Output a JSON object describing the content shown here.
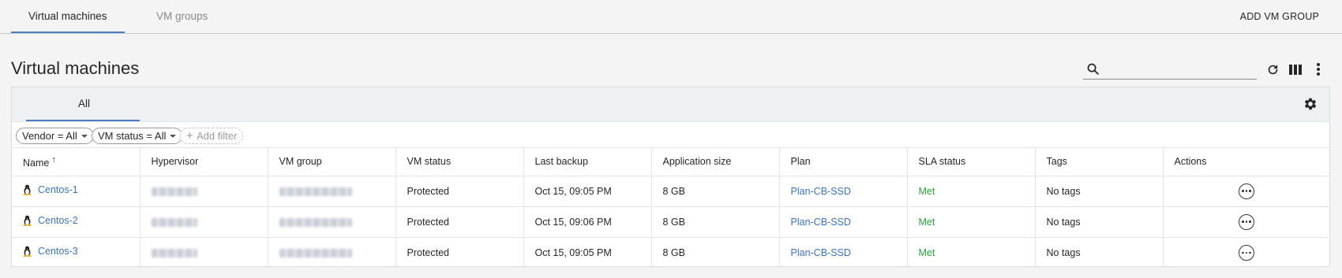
{
  "tabs": [
    {
      "label": "Virtual machines",
      "active": true
    },
    {
      "label": "VM groups",
      "active": false
    }
  ],
  "header": {
    "add_group_label": "ADD VM GROUP",
    "title": "Virtual machines"
  },
  "search": {
    "value": "",
    "placeholder": ""
  },
  "toolbar_icons": [
    "search-icon",
    "refresh-icon",
    "columns-icon",
    "more-vertical-icon"
  ],
  "panel": {
    "subtab_label": "All",
    "filters": [
      {
        "label": "Vendor = All"
      },
      {
        "label": "VM status = All"
      }
    ],
    "add_filter_label": "Add filter"
  },
  "table": {
    "columns": [
      "Name",
      "Hypervisor",
      "VM group",
      "VM status",
      "Last backup",
      "Application size",
      "Plan",
      "SLA status",
      "Tags",
      "Actions"
    ],
    "sort_indicator": "↑",
    "rows": [
      {
        "name": "Centos-1",
        "vm_status": "Protected",
        "last_backup": "Oct 15, 09:05 PM",
        "app_size": "8 GB",
        "plan": "Plan-CB-SSD",
        "sla": "Met",
        "tags": "No tags"
      },
      {
        "name": "Centos-2",
        "vm_status": "Protected",
        "last_backup": "Oct 15, 09:06 PM",
        "app_size": "8 GB",
        "plan": "Plan-CB-SSD",
        "sla": "Met",
        "tags": "No tags"
      },
      {
        "name": "Centos-3",
        "vm_status": "Protected",
        "last_backup": "Oct 15, 09:05 PM",
        "app_size": "8 GB",
        "plan": "Plan-CB-SSD",
        "sla": "Met",
        "tags": "No tags"
      }
    ]
  },
  "colors": {
    "accent": "#4a7fc1",
    "link": "#3b73b9",
    "met": "#2e9e3f"
  }
}
